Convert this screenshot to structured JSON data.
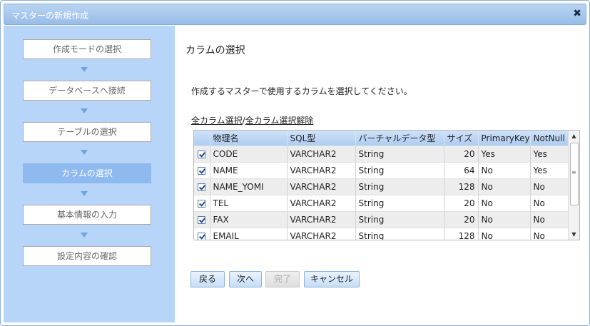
{
  "window": {
    "title": "マスターの新規作成",
    "close_glyph": "✖"
  },
  "steps": [
    {
      "label": "作成モードの選択",
      "active": false
    },
    {
      "label": "データベースへ接続",
      "active": false
    },
    {
      "label": "テーブルの選択",
      "active": false
    },
    {
      "label": "カラムの選択",
      "active": true
    },
    {
      "label": "基本情報の入力",
      "active": false
    },
    {
      "label": "設定内容の確認",
      "active": false
    }
  ],
  "main": {
    "title": "カラムの選択",
    "description": "作成するマスターで使用するカラムを選択してください。",
    "select_all": "全カラム選択",
    "separator": "/",
    "deselect_all": "全カラム選択解除"
  },
  "grid": {
    "columns": [
      "物理名",
      "SQL型",
      "バーチャルデータ型",
      "サイズ",
      "PrimaryKey",
      "NotNull"
    ],
    "rows": [
      {
        "checked": true,
        "name": "CODE",
        "sql": "VARCHAR2",
        "vtype": "String",
        "size": "20",
        "pk": "Yes",
        "nn": "Yes"
      },
      {
        "checked": true,
        "name": "NAME",
        "sql": "VARCHAR2",
        "vtype": "String",
        "size": "64",
        "pk": "No",
        "nn": "Yes"
      },
      {
        "checked": true,
        "name": "NAME_YOMI",
        "sql": "VARCHAR2",
        "vtype": "String",
        "size": "128",
        "pk": "No",
        "nn": "No"
      },
      {
        "checked": true,
        "name": "TEL",
        "sql": "VARCHAR2",
        "vtype": "String",
        "size": "20",
        "pk": "No",
        "nn": "No"
      },
      {
        "checked": true,
        "name": "FAX",
        "sql": "VARCHAR2",
        "vtype": "String",
        "size": "20",
        "pk": "No",
        "nn": "No"
      },
      {
        "checked": true,
        "name": "EMAIL",
        "sql": "VARCHAR2",
        "vtype": "String",
        "size": "128",
        "pk": "No",
        "nn": "No"
      }
    ],
    "scroll_up": "▲",
    "scroll_down": "▼",
    "scroll_grip": "≡"
  },
  "buttons": {
    "back": "戻る",
    "next": "次へ",
    "finish": "完了",
    "cancel": "キャンセル"
  },
  "colors": {
    "sidebar": "#b7d5f8",
    "active_step": "#8ebaf0",
    "header": "#aecdf1"
  }
}
